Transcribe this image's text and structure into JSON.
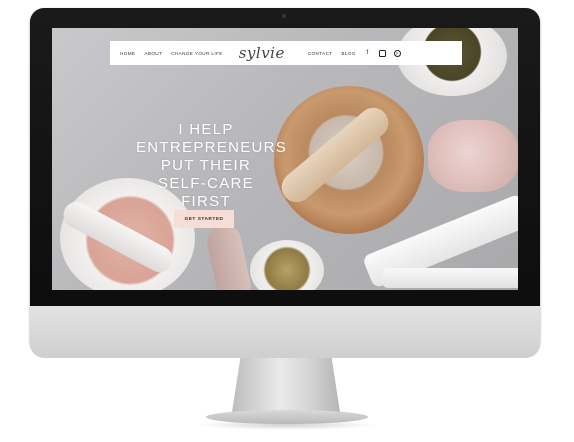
{
  "nav": {
    "links_left": [
      "HOME",
      "ABOUT",
      "CHANGE YOUR LIFE"
    ],
    "logo": "sylvie",
    "links_right": [
      "CONTACT",
      "BLOG"
    ],
    "social": [
      {
        "icon": "facebook-icon",
        "glyph": "f"
      },
      {
        "icon": "instagram-icon",
        "glyph": "◎"
      },
      {
        "icon": "pinterest-icon",
        "glyph": "p"
      }
    ]
  },
  "hero": {
    "lines": [
      "I HELP",
      "ENTREPRENEURS",
      "PUT THEIR",
      "SELF-CARE FIRST"
    ],
    "cta_label": "GET STARTED"
  },
  "colors": {
    "cta_background": "#f6ddd6",
    "nav_background": "#ffffff",
    "hero_text": "#ffffff"
  }
}
